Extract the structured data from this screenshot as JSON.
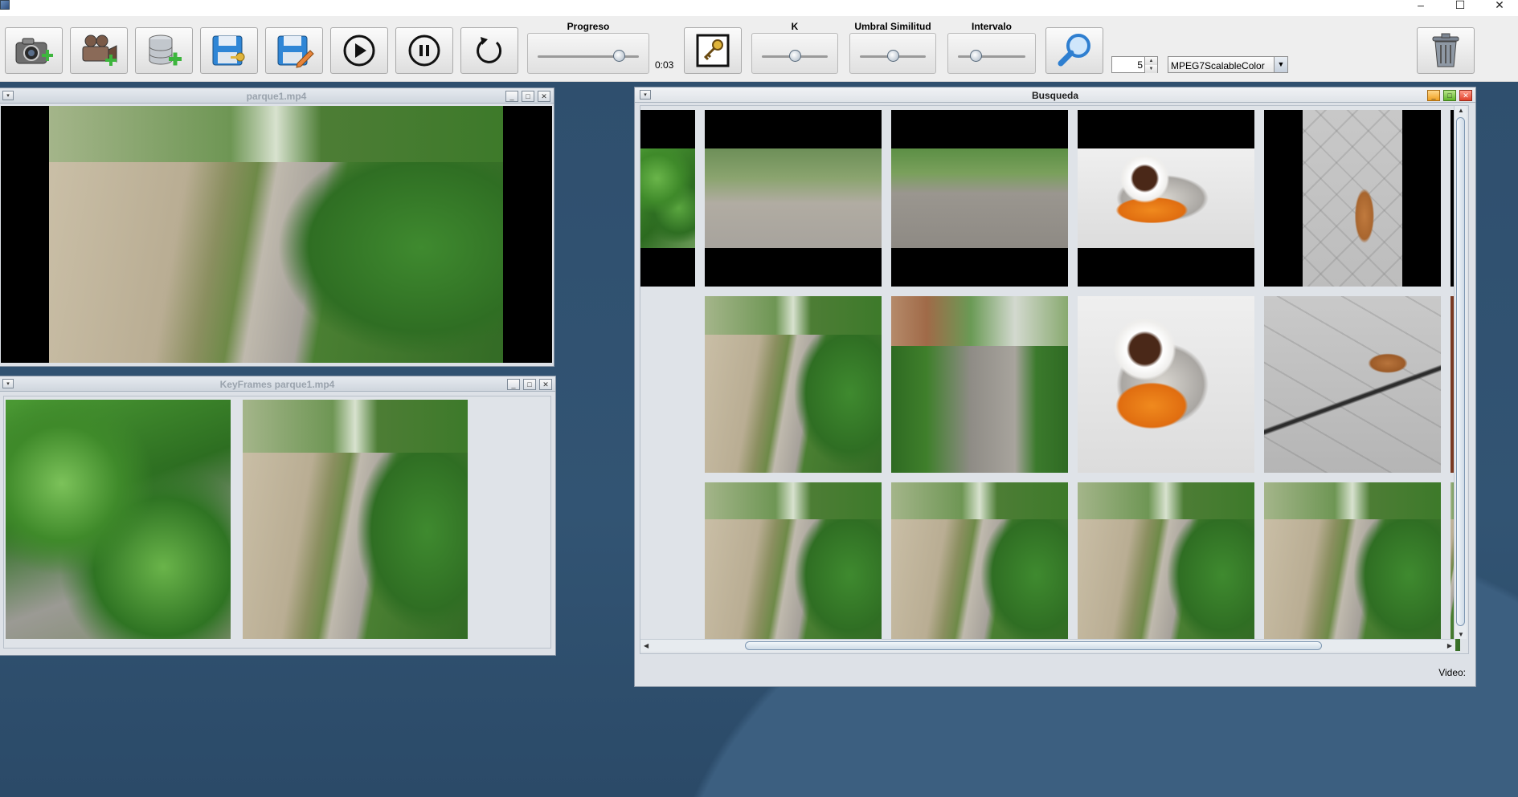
{
  "window": {
    "minimize_glyph": "–",
    "maximize_glyph": "☐",
    "close_glyph": "✕"
  },
  "toolbar": {
    "buttons": [
      {
        "name": "open-image-button",
        "icon": "camera-add-icon"
      },
      {
        "name": "open-video-button",
        "icon": "video-camera-add-icon"
      },
      {
        "name": "add-database-button",
        "icon": "database-add-icon"
      },
      {
        "name": "save-key-button",
        "icon": "floppy-key-icon"
      },
      {
        "name": "save-edit-button",
        "icon": "floppy-edit-icon"
      },
      {
        "name": "play-button",
        "icon": "play-icon"
      },
      {
        "name": "pause-button",
        "icon": "pause-icon"
      },
      {
        "name": "restart-button",
        "icon": "reload-icon"
      },
      {
        "name": "keyframes-button",
        "icon": "key-frame-icon"
      },
      {
        "name": "search-button",
        "icon": "magnifier-icon"
      },
      {
        "name": "delete-button",
        "icon": "trash-icon"
      }
    ],
    "progress_label": "Progreso",
    "progress_value": 0.85,
    "time": "0:03",
    "k_label": "K",
    "k_value": 0.5,
    "threshold_label": "Umbral Similitud",
    "threshold_value": 0.5,
    "interval_label": "Intervalo",
    "interval_value": 0.22,
    "result_count": "5",
    "spin_up": "▲",
    "spin_down": "▼",
    "descriptor": "MPEG7ScalableColor",
    "combo_arrow": "▼"
  },
  "video_window": {
    "title": "parque1.mp4",
    "menu_glyph": "▾",
    "min_glyph": "_",
    "max_glyph": "□",
    "close_glyph": "✕"
  },
  "keyframes_window": {
    "title": "KeyFrames parque1.mp4",
    "menu_glyph": "▾",
    "min_glyph": "_",
    "max_glyph": "□",
    "close_glyph": "✕",
    "frames": [
      "keyframe-bushes",
      "keyframe-canal-path"
    ]
  },
  "search_window": {
    "title": "Busqueda",
    "menu_glyph": "▾",
    "min_glyph": "_",
    "max_glyph": "□",
    "close_glyph": "✕",
    "status_label": "Video:",
    "rows": [
      [
        "park-with-bench",
        "sunny-sidewalk",
        "churros-chocolate",
        "dog-on-street"
      ],
      [
        "park-canal-trees",
        "street-hedge",
        "churros-chocolate-close",
        "dog-lying-tiles"
      ],
      [
        "canal-path-1",
        "canal-path-2",
        "canal-path-3",
        "canal-path-4"
      ]
    ],
    "scroll_up": "▲",
    "scroll_down": "▼",
    "scroll_left": "◀",
    "scroll_right": "▶"
  }
}
